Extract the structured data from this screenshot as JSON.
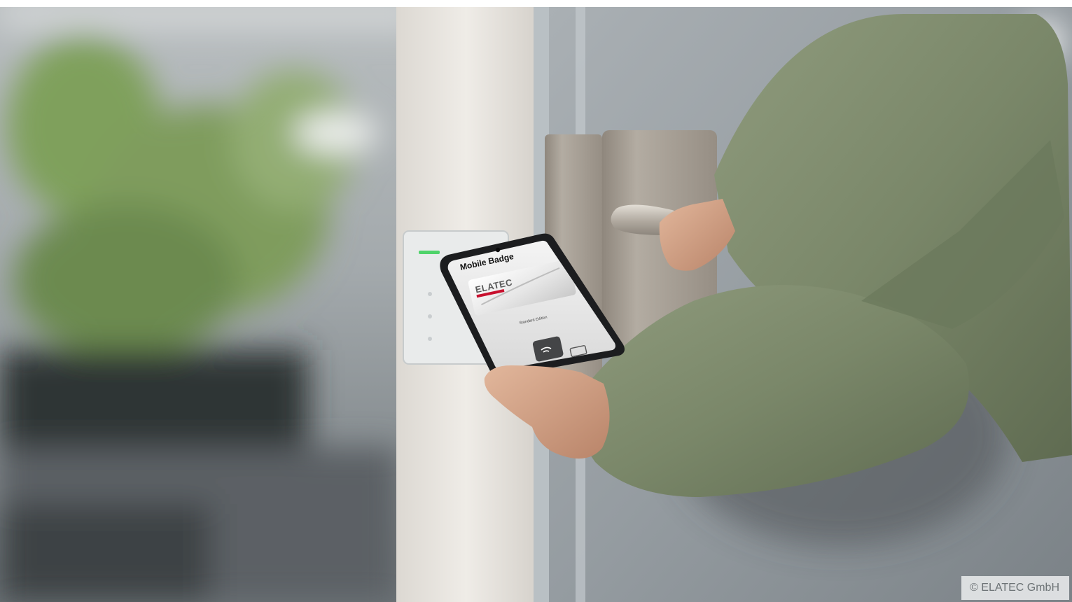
{
  "photo": {
    "credit": "© ELATEC GmbH",
    "phone_screen": {
      "title": "Mobile Badge",
      "card_logo": "ELATEC",
      "card_caption": "Standard Edition"
    }
  },
  "colors": {
    "background_blur": "#8c9397",
    "door_frame": "#e7e3dd",
    "door_glass": "#9aa1a6",
    "handle_metal": "#a49d94",
    "sleeve_green": "#7d8a6c",
    "reader_led": "#4fd36a",
    "brand_red": "#c8102e"
  }
}
